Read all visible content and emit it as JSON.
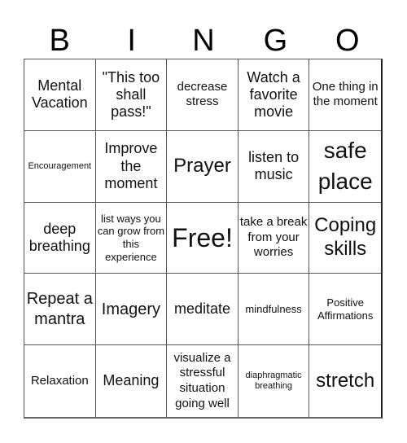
{
  "header": {
    "letters": [
      "B",
      "I",
      "N",
      "G",
      "O"
    ]
  },
  "board": {
    "rows": [
      [
        "Mental Vacation",
        "\"This too shall pass!\"",
        "decrease stress",
        "Watch a favorite movie",
        "One thing in the moment"
      ],
      [
        "Encouragement",
        "Improve the moment",
        "Prayer",
        "listen to music",
        "safe place"
      ],
      [
        "deep breathing",
        "list ways you can grow from this experience",
        "Free!",
        "take a break from your worries",
        "Coping skills"
      ],
      [
        "Repeat a mantra",
        "Imagery",
        "meditate",
        "mindfulness",
        "Positive Affirmations"
      ],
      [
        "Relaxation",
        "Meaning",
        "visualize a stressful situation going well",
        "diaphragmatic breathing",
        "stretch"
      ]
    ],
    "free_space": "Free!"
  }
}
